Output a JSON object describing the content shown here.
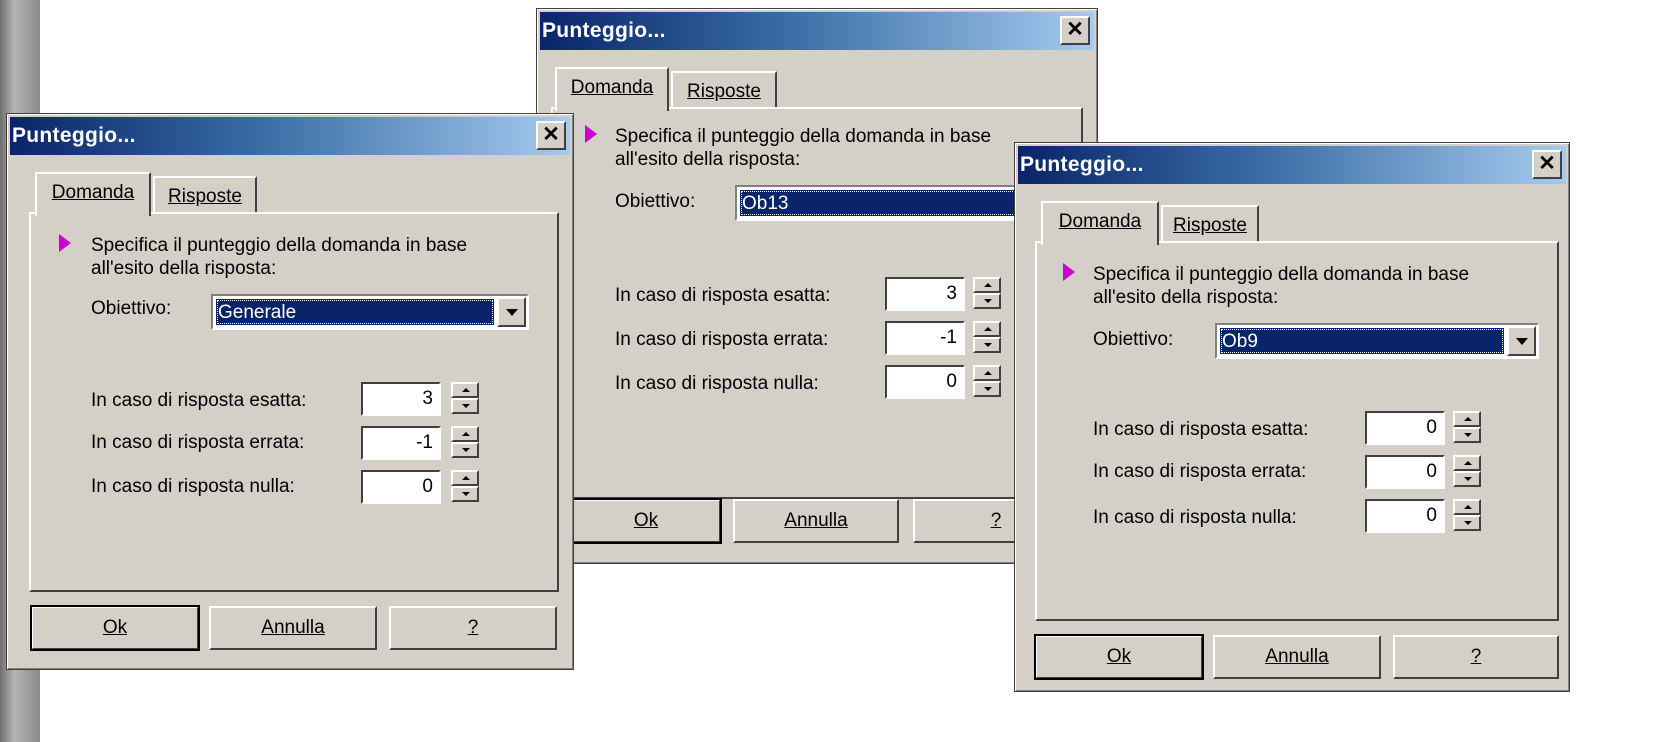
{
  "dialogs": [
    {
      "title": "Punteggio...",
      "close_label": "✕",
      "tabs": {
        "domanda": "Domanda",
        "risposte": "Risposte"
      },
      "description": "Specifica il punteggio della domanda in base all'esito della risposta:",
      "obiettivo_label": "Obiettivo:",
      "obiettivo_value": "Generale",
      "rows": [
        {
          "label": "In caso di risposta esatta:",
          "value": "3"
        },
        {
          "label": "In caso di risposta errata:",
          "value": "-1"
        },
        {
          "label": "In caso di risposta nulla:",
          "value": "0"
        }
      ],
      "buttons": {
        "ok": "Ok",
        "annulla": "Annulla",
        "help": "?"
      }
    },
    {
      "title": "Punteggio...",
      "close_label": "✕",
      "tabs": {
        "domanda": "Domanda",
        "risposte": "Risposte"
      },
      "description": "Specifica il punteggio della domanda in base all'esito della risposta:",
      "obiettivo_label": "Obiettivo:",
      "obiettivo_value": "Ob13",
      "rows": [
        {
          "label": "In caso di risposta esatta:",
          "value": "3"
        },
        {
          "label": "In caso di risposta errata:",
          "value": "-1"
        },
        {
          "label": "In caso di risposta nulla:",
          "value": "0"
        }
      ],
      "buttons": {
        "ok": "Ok",
        "annulla": "Annulla",
        "help": "?"
      }
    },
    {
      "title": "Punteggio...",
      "close_label": "✕",
      "tabs": {
        "domanda": "Domanda",
        "risposte": "Risposte"
      },
      "description": "Specifica il punteggio della domanda in base all'esito della risposta:",
      "obiettivo_label": "Obiettivo:",
      "obiettivo_value": "Ob9",
      "rows": [
        {
          "label": "In caso di risposta esatta:",
          "value": "0"
        },
        {
          "label": "In caso di risposta errata:",
          "value": "0"
        },
        {
          "label": "In caso di risposta nulla:",
          "value": "0"
        }
      ],
      "buttons": {
        "ok": "Ok",
        "annulla": "Annulla",
        "help": "?"
      }
    }
  ]
}
